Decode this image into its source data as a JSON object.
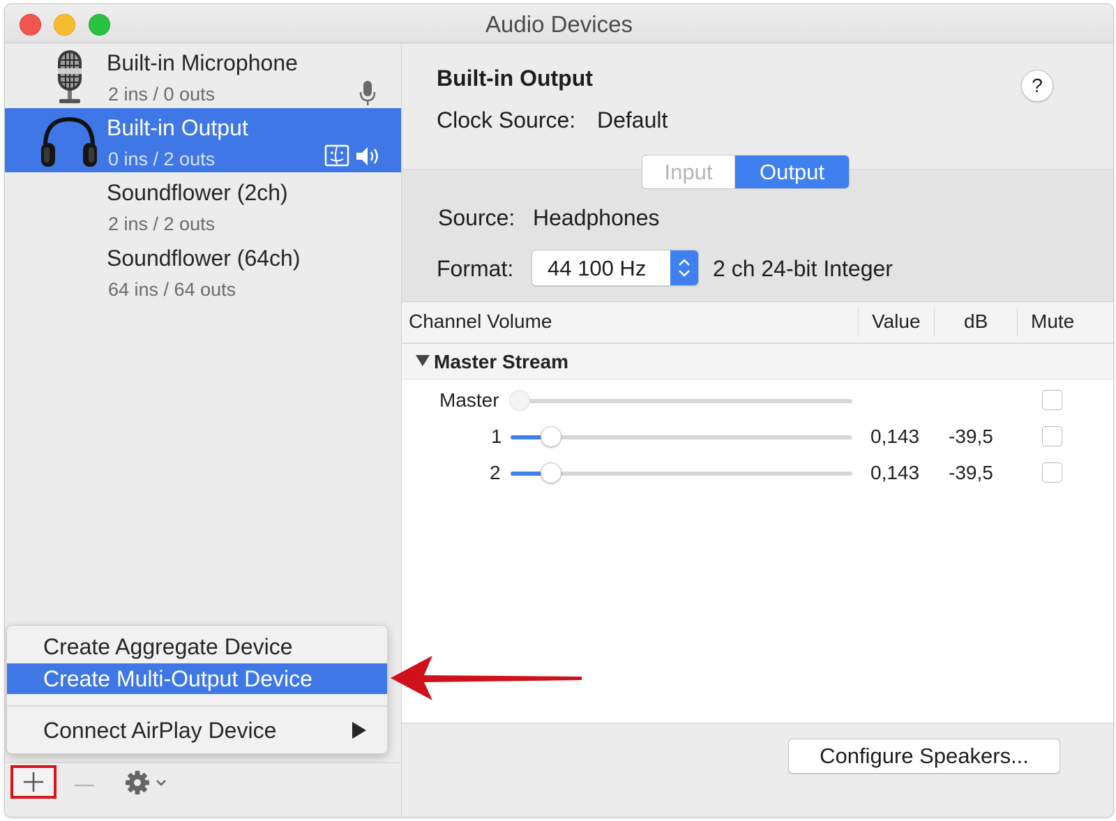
{
  "window": {
    "title": "Audio Devices"
  },
  "devices": [
    {
      "name": "Built-in Microphone",
      "io": "2 ins / 0 outs",
      "icon": "microphone-icon",
      "selected": false
    },
    {
      "name": "Built-in Output",
      "io": "0 ins / 2 outs",
      "icon": "headphones-icon",
      "selected": true
    },
    {
      "name": "Soundflower (2ch)",
      "io": "2 ins / 2 outs",
      "selected": false
    },
    {
      "name": "Soundflower (64ch)",
      "io": "64 ins / 64 outs",
      "selected": false
    }
  ],
  "context_menu": {
    "items": [
      {
        "label": "Create Aggregate Device",
        "highlighted": false
      },
      {
        "label": "Create Multi-Output Device",
        "highlighted": true
      },
      {
        "label": "Connect AirPlay Device",
        "submenu": true
      }
    ]
  },
  "detail": {
    "title": "Built-in Output",
    "clock_source_label": "Clock Source:",
    "clock_source_value": "Default",
    "help": "?",
    "tabs": [
      {
        "label": "Input",
        "active": false
      },
      {
        "label": "Output",
        "active": true
      }
    ],
    "source_label": "Source:",
    "source_value": "Headphones",
    "format_label": "Format:",
    "format_rate": "44 100 Hz",
    "format_desc": "2 ch 24-bit Integer"
  },
  "channels": {
    "columns": [
      "Channel Volume",
      "Value",
      "dB",
      "Mute"
    ],
    "group": "Master Stream",
    "rows": [
      {
        "label": "Master",
        "level": 0.0,
        "enabled": false,
        "value": "",
        "db": "",
        "mute": false
      },
      {
        "label": "1",
        "level": 0.143,
        "enabled": true,
        "value": "0,143",
        "db": "-39,5",
        "mute": false
      },
      {
        "label": "2",
        "level": 0.143,
        "enabled": true,
        "value": "0,143",
        "db": "-39,5",
        "mute": false
      }
    ]
  },
  "footer": {
    "configure_label": "Configure Speakers..."
  },
  "colors": {
    "accent": "#3f78e6",
    "highlight_box": "#d8141a",
    "arrow": "#d0101a"
  }
}
